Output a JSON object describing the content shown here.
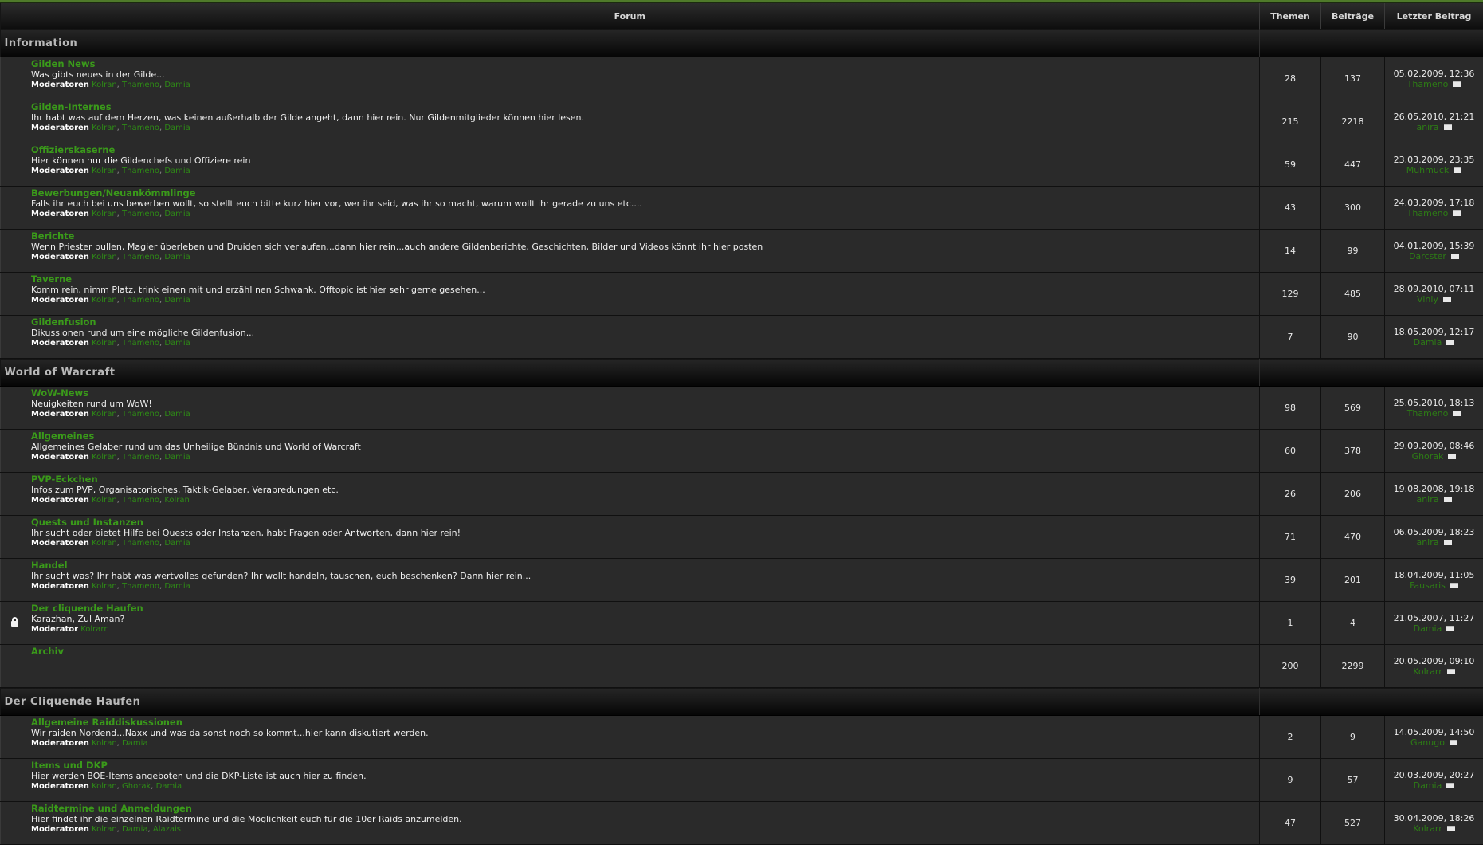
{
  "header": {
    "forum": "Forum",
    "topics": "Themen",
    "posts": "Beiträge",
    "last_post": "Letzter Beitrag"
  },
  "categories": [
    {
      "name": "Information",
      "forums": [
        {
          "name": "Gilden News",
          "desc": "Was gibts neues in der Gilde...",
          "mods_label": "Moderatoren",
          "mods": [
            "Kolran",
            "Thameno",
            "Damia"
          ],
          "topics": "28",
          "posts": "137",
          "last_date": "05.02.2009, 12:36",
          "last_user": "Thameno",
          "locked": false
        },
        {
          "name": "Gilden-Internes",
          "desc": "Ihr habt was auf dem Herzen, was keinen außerhalb der Gilde angeht, dann hier rein. Nur Gildenmitglieder können hier lesen.",
          "mods_label": "Moderatoren",
          "mods": [
            "Kolran",
            "Thameno",
            "Damia"
          ],
          "topics": "215",
          "posts": "2218",
          "last_date": "26.05.2010, 21:21",
          "last_user": "anira",
          "locked": false
        },
        {
          "name": "Offizierskaserne",
          "desc": "Hier können nur die Gildenchefs und Offiziere rein",
          "mods_label": "Moderatoren",
          "mods": [
            "Kolran",
            "Thameno",
            "Damia"
          ],
          "topics": "59",
          "posts": "447",
          "last_date": "23.03.2009, 23:35",
          "last_user": "Muhmuck",
          "locked": false
        },
        {
          "name": "Bewerbungen/Neuankömmlinge",
          "desc": "Falls ihr euch bei uns bewerben wollt, so stellt euch bitte kurz hier vor, wer ihr seid, was ihr so macht, warum wollt ihr gerade zu uns etc....",
          "mods_label": "Moderatoren",
          "mods": [
            "Kolran",
            "Thameno",
            "Damia"
          ],
          "topics": "43",
          "posts": "300",
          "last_date": "24.03.2009, 17:18",
          "last_user": "Thameno",
          "locked": false
        },
        {
          "name": "Berichte",
          "desc": "Wenn Priester pullen, Magier überleben und Druiden sich verlaufen...dann hier rein...auch andere Gildenberichte, Geschichten, Bilder und Videos könnt ihr hier posten",
          "mods_label": "Moderatoren",
          "mods": [
            "Kolran",
            "Thameno",
            "Damia"
          ],
          "topics": "14",
          "posts": "99",
          "last_date": "04.01.2009, 15:39",
          "last_user": "Darcster",
          "locked": false
        },
        {
          "name": "Taverne",
          "desc": "Komm rein, nimm Platz, trink einen mit und erzähl nen Schwank. Offtopic ist hier sehr gerne gesehen...",
          "mods_label": "Moderatoren",
          "mods": [
            "Kolran",
            "Thameno",
            "Damia"
          ],
          "topics": "129",
          "posts": "485",
          "last_date": "28.09.2010, 07:11",
          "last_user": "Vinly",
          "locked": false
        },
        {
          "name": "Gildenfusion",
          "desc": "Dikussionen rund um eine mögliche Gildenfusion...",
          "mods_label": "Moderatoren",
          "mods": [
            "Kolran",
            "Thameno",
            "Damia"
          ],
          "topics": "7",
          "posts": "90",
          "last_date": "18.05.2009, 12:17",
          "last_user": "Damia",
          "locked": false
        }
      ]
    },
    {
      "name": "World of Warcraft",
      "forums": [
        {
          "name": "WoW-News",
          "desc": "Neuigkeiten rund um WoW!",
          "mods_label": "Moderatoren",
          "mods": [
            "Kolran",
            "Thameno",
            "Damia"
          ],
          "topics": "98",
          "posts": "569",
          "last_date": "25.05.2010, 18:13",
          "last_user": "Thameno",
          "locked": false
        },
        {
          "name": "Allgemeines",
          "desc": "Allgemeines Gelaber rund um das Unheilige Bündnis und World of Warcraft",
          "mods_label": "Moderatoren",
          "mods": [
            "Kolran",
            "Thameno",
            "Damia"
          ],
          "topics": "60",
          "posts": "378",
          "last_date": "29.09.2009, 08:46",
          "last_user": "Ghorak",
          "locked": false
        },
        {
          "name": "PVP-Eckchen",
          "desc": "Infos zum PVP, Organisatorisches, Taktik-Gelaber, Verabredungen etc.",
          "mods_label": "Moderatoren",
          "mods": [
            "Kolran",
            "Thameno",
            "Kolran"
          ],
          "topics": "26",
          "posts": "206",
          "last_date": "19.08.2008, 19:18",
          "last_user": "anira",
          "locked": false
        },
        {
          "name": "Quests und Instanzen",
          "desc": "Ihr sucht oder bietet Hilfe bei Quests oder Instanzen, habt Fragen oder Antworten, dann hier rein!",
          "mods_label": "Moderatoren",
          "mods": [
            "Kolran",
            "Thameno",
            "Damia"
          ],
          "topics": "71",
          "posts": "470",
          "last_date": "06.05.2009, 18:23",
          "last_user": "anira",
          "locked": false
        },
        {
          "name": "Handel",
          "desc": "Ihr sucht was? Ihr habt was wertvolles gefunden? Ihr wollt handeln, tauschen, euch beschenken? Dann hier rein...",
          "mods_label": "Moderatoren",
          "mods": [
            "Kolran",
            "Thameno",
            "Damia"
          ],
          "topics": "39",
          "posts": "201",
          "last_date": "18.04.2009, 11:05",
          "last_user": "Fausaris",
          "locked": false
        },
        {
          "name": "Der cliquende Haufen",
          "desc": "Karazhan, Zul Aman?",
          "mods_label": "Moderator",
          "mods": [
            "Kolrarr"
          ],
          "topics": "1",
          "posts": "4",
          "last_date": "21.05.2007, 11:27",
          "last_user": "Damia",
          "locked": true
        },
        {
          "name": "Archiv",
          "desc": "",
          "mods_label": "",
          "mods": [],
          "topics": "200",
          "posts": "2299",
          "last_date": "20.05.2009, 09:10",
          "last_user": "Kolrarr",
          "locked": false
        }
      ]
    },
    {
      "name": "Der Cliquende Haufen",
      "forums": [
        {
          "name": "Allgemeine Raiddiskussionen",
          "desc": "Wir raiden Nordend...Naxx und was da sonst noch so kommt...hier kann diskutiert werden.",
          "mods_label": "Moderatoren",
          "mods": [
            "Kolran",
            "Damia"
          ],
          "topics": "2",
          "posts": "9",
          "last_date": "14.05.2009, 14:50",
          "last_user": "Ganugo",
          "locked": false
        },
        {
          "name": "Items und DKP",
          "desc": "Hier werden BOE-Items angeboten und die DKP-Liste ist auch hier zu finden.",
          "mods_label": "Moderatoren",
          "mods": [
            "Kolran",
            "Ghorak",
            "Damia"
          ],
          "topics": "9",
          "posts": "57",
          "last_date": "20.03.2009, 20:27",
          "last_user": "Damia",
          "locked": false
        },
        {
          "name": "Raidtermine und Anmeldungen",
          "desc": "Hier findet ihr die einzelnen Raidtermine und die Möglichkeit euch für die 10er Raids anzumelden.",
          "mods_label": "Moderatoren",
          "mods": [
            "Kolran",
            "Damia",
            "Alazais"
          ],
          "topics": "47",
          "posts": "527",
          "last_date": "30.04.2009, 18:26",
          "last_user": "Kolrarr",
          "locked": false
        }
      ]
    }
  ]
}
